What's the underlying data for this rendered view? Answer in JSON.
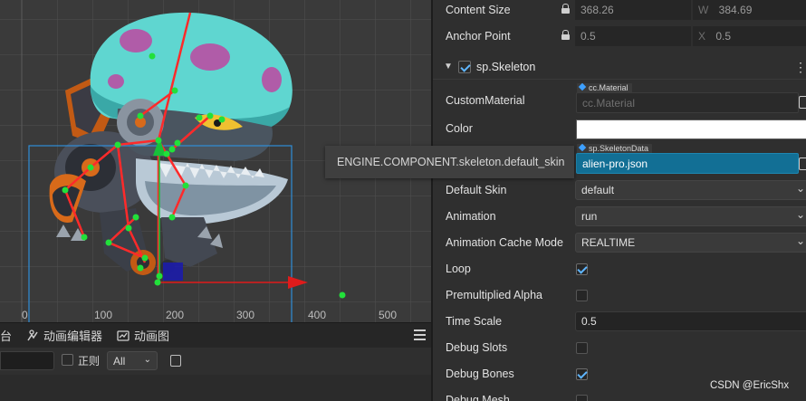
{
  "scene": {
    "ruler_labels": [
      "0",
      "100",
      "200",
      "300",
      "400",
      "500"
    ],
    "colors": {
      "background": "#3a3a3a",
      "grid": "#555555",
      "bone": "#ff2a2a",
      "joint": "#22e03a",
      "bounds": "#2f8ed8",
      "axis_x": "#e01b1b",
      "axis_y": "#17c13a",
      "anchor": "#1c1caa"
    }
  },
  "bottom": {
    "tabs": [
      {
        "label": "台",
        "icon": "console-icon"
      },
      {
        "label": "动画编辑器",
        "icon": "animation-editor-icon"
      },
      {
        "label": "动画图",
        "icon": "animation-graph-icon"
      }
    ],
    "regex_label": "正则",
    "level_value": "All",
    "search_value": ""
  },
  "inspector": {
    "content_size": {
      "label": "Content Size",
      "w_axis": "W",
      "w_value": "368.26",
      "h_value": "384.69"
    },
    "anchor_point": {
      "label": "Anchor Point",
      "x_axis": "X",
      "x_value": "0.5",
      "y_value": "0.5"
    },
    "component_title": "sp.Skeleton",
    "custom_material": {
      "label": "CustomMaterial",
      "tag": "cc.Material",
      "placeholder": "cc.Material"
    },
    "color_label": "Color",
    "skeleton_data": {
      "tag": "sp.SkeletonData",
      "value": "alien-pro.json"
    },
    "default_skin": {
      "label": "Default Skin",
      "value": "default"
    },
    "animation": {
      "label": "Animation",
      "value": "run"
    },
    "cache_mode": {
      "label": "Animation Cache Mode",
      "value": "REALTIME"
    },
    "loop": {
      "label": "Loop",
      "checked": true
    },
    "premultiplied_alpha": {
      "label": "Premultiplied Alpha",
      "checked": false
    },
    "time_scale": {
      "label": "Time Scale",
      "value": "0.5"
    },
    "debug_slots": {
      "label": "Debug Slots",
      "checked": false
    },
    "debug_bones": {
      "label": "Debug Bones",
      "checked": true
    },
    "debug_mesh": {
      "label": "Debug Mesh",
      "checked": false
    }
  },
  "tooltip": "ENGINE.COMPONENT.skeleton.default_skin",
  "watermark": "CSDN @EricShx"
}
